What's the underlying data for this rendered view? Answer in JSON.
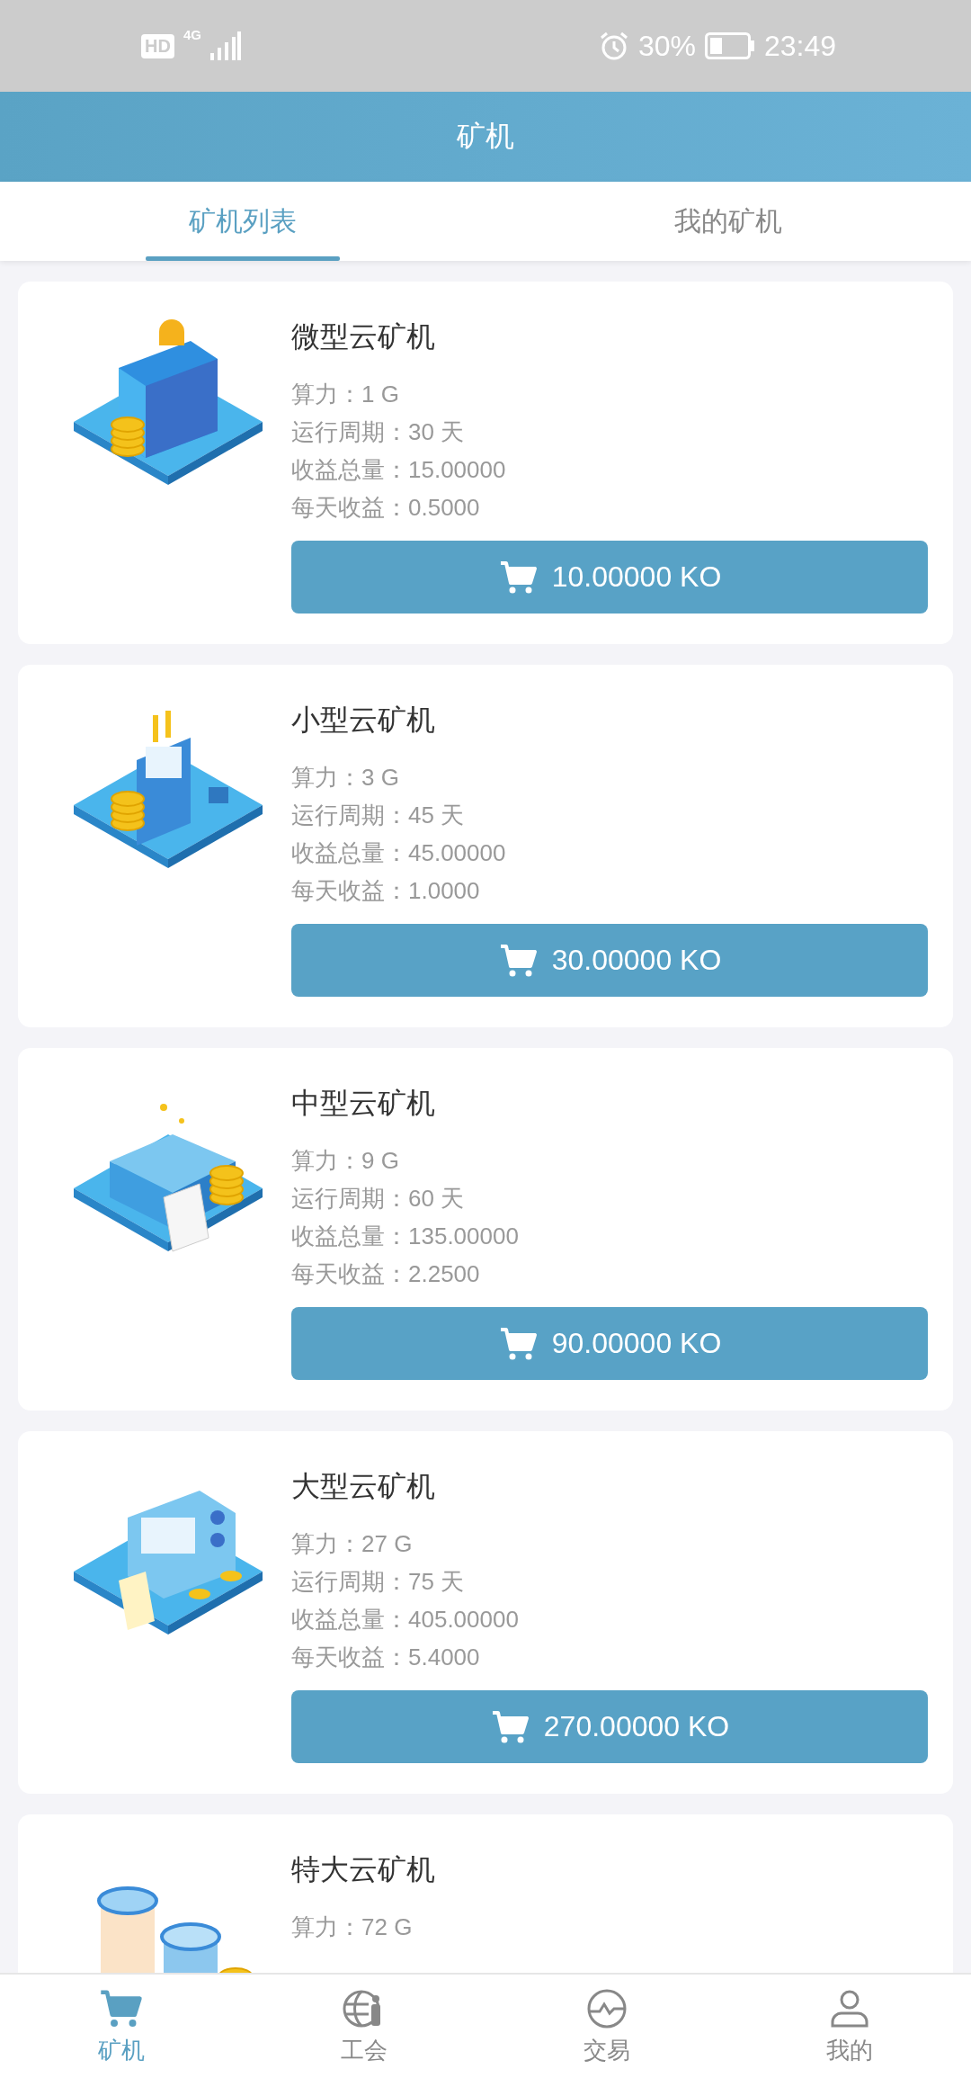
{
  "status_bar": {
    "hd": "HD",
    "network": "4G",
    "battery": "30%",
    "time": "23:49"
  },
  "header": {
    "title": "矿机"
  },
  "tabs": [
    {
      "label": "矿机列表",
      "selected": true
    },
    {
      "label": "我的矿机",
      "selected": false
    }
  ],
  "machines": [
    {
      "kind": "safe",
      "name": "微型云矿机",
      "lines": [
        "算力：1 G",
        "运行周期：30 天",
        "收益总量：15.00000",
        "每天收益：0.5000"
      ],
      "price": "10.00000 KO"
    },
    {
      "kind": "terminal",
      "name": "小型云矿机",
      "lines": [
        "算力：3 G",
        "运行周期：45 天",
        "收益总量：45.00000",
        "每天收益：1.0000"
      ],
      "price": "30.00000 KO"
    },
    {
      "kind": "printer",
      "name": "中型云矿机",
      "lines": [
        "算力：9 G",
        "运行周期：60 天",
        "收益总量：135.00000",
        "每天收益：2.2500"
      ],
      "price": "90.00000 KO"
    },
    {
      "kind": "register",
      "name": "大型云矿机",
      "lines": [
        "算力：27 G",
        "运行周期：75 天",
        "收益总量：405.00000",
        "每天收益：5.4000"
      ],
      "price": "270.00000 KO"
    },
    {
      "kind": "jars",
      "name": "特大云矿机",
      "lines": [
        "算力：72 G"
      ]
    }
  ],
  "nav": [
    {
      "kind": "cart",
      "label": "矿机",
      "selected": true
    },
    {
      "kind": "globe",
      "label": "工会",
      "selected": false
    },
    {
      "kind": "trade",
      "label": "交易",
      "selected": false
    },
    {
      "kind": "person",
      "label": "我的",
      "selected": false
    }
  ]
}
